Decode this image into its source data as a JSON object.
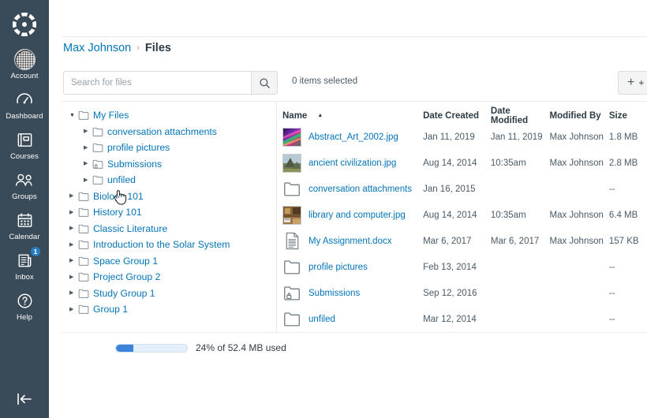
{
  "globalnav": {
    "logo_icon": "canvas-logo-icon",
    "collapse_icon": "collapse-nav-icon",
    "items": [
      {
        "label": "Account",
        "icon": "account-avatar-icon",
        "badge": null
      },
      {
        "label": "Dashboard",
        "icon": "dashboard-icon",
        "badge": null
      },
      {
        "label": "Courses",
        "icon": "courses-icon",
        "badge": null
      },
      {
        "label": "Groups",
        "icon": "groups-icon",
        "badge": null
      },
      {
        "label": "Calendar",
        "icon": "calendar-icon",
        "badge": null
      },
      {
        "label": "Inbox",
        "icon": "inbox-icon",
        "badge": "1"
      },
      {
        "label": "Help",
        "icon": "help-icon",
        "badge": null
      }
    ]
  },
  "breadcrumb": {
    "root": "Max Johnson",
    "separator": "›",
    "current": "Files"
  },
  "toolbar": {
    "search_placeholder": "Search for files",
    "search_value": "",
    "search_icon": "search-icon",
    "selected_text": "0 items selected",
    "folder_button_label": "+ Fol",
    "folder_button_plus": "+"
  },
  "tree": {
    "items": [
      {
        "label": "My Files",
        "level": 0,
        "expanded": true,
        "icon": "folder-icon"
      },
      {
        "label": "conversation attachments",
        "level": 1,
        "expanded": false,
        "icon": "folder-icon"
      },
      {
        "label": "profile pictures",
        "level": 1,
        "expanded": false,
        "icon": "folder-icon"
      },
      {
        "label": "Submissions",
        "level": 1,
        "expanded": false,
        "icon": "folder-locked-icon"
      },
      {
        "label": "unfiled",
        "level": 1,
        "expanded": false,
        "icon": "folder-icon"
      },
      {
        "label": "Biology 101",
        "level": 0,
        "expanded": false,
        "icon": "folder-icon"
      },
      {
        "label": "History 101",
        "level": 0,
        "expanded": false,
        "icon": "folder-icon"
      },
      {
        "label": "Classic Literature",
        "level": 0,
        "expanded": false,
        "icon": "folder-icon"
      },
      {
        "label": "Introduction to the Solar System",
        "level": 0,
        "expanded": false,
        "icon": "folder-icon"
      },
      {
        "label": "Space Group 1",
        "level": 0,
        "expanded": false,
        "icon": "folder-icon"
      },
      {
        "label": "Project Group 2",
        "level": 0,
        "expanded": false,
        "icon": "folder-icon"
      },
      {
        "label": "Study Group 1",
        "level": 0,
        "expanded": false,
        "icon": "folder-icon"
      },
      {
        "label": "Group 1",
        "level": 0,
        "expanded": false,
        "icon": "folder-icon"
      }
    ]
  },
  "table": {
    "columns": [
      "Name",
      "Date Created",
      "Date Modified",
      "Modified By",
      "Size"
    ],
    "sort_column": "Name",
    "sort_direction": "asc",
    "sort_arrow": "▲",
    "rows": [
      {
        "name": "Abstract_Art_2002.jpg",
        "thumb": "image-thumb-abstract-art",
        "date_created": "Jan 11, 2019",
        "date_modified": "Jan 11, 2019",
        "modified_by": "Max Johnson",
        "size": "1.8 MB"
      },
      {
        "name": "ancient civilization.jpg",
        "thumb": "image-thumb-mountain",
        "date_created": "Aug 14, 2014",
        "date_modified": "10:35am",
        "modified_by": "Max Johnson",
        "size": "2.8 MB"
      },
      {
        "name": "conversation attachments",
        "thumb": "folder-icon",
        "date_created": "Jan 16, 2015",
        "date_modified": "",
        "modified_by": "",
        "size": "--"
      },
      {
        "name": "library and computer.jpg",
        "thumb": "image-thumb-library",
        "date_created": "Aug 14, 2014",
        "date_modified": "10:35am",
        "modified_by": "Max Johnson",
        "size": "6.4 MB"
      },
      {
        "name": "My Assignment.docx",
        "thumb": "document-icon",
        "date_created": "Mar 6, 2017",
        "date_modified": "Mar 6, 2017",
        "modified_by": "Max Johnson",
        "size": "157 KB"
      },
      {
        "name": "profile pictures",
        "thumb": "folder-icon",
        "date_created": "Feb 13, 2014",
        "date_modified": "",
        "modified_by": "",
        "size": "--"
      },
      {
        "name": "Submissions",
        "thumb": "folder-locked-icon",
        "date_created": "Sep 12, 2016",
        "date_modified": "",
        "modified_by": "",
        "size": "--"
      },
      {
        "name": "unfiled",
        "thumb": "folder-icon",
        "date_created": "Mar 12, 2014",
        "date_modified": "",
        "modified_by": "",
        "size": "--"
      }
    ]
  },
  "storage": {
    "percent": 24,
    "text": "24% of 52.4 MB used",
    "fill_color": "#3B82D9",
    "track_color": "#E5EFF9"
  },
  "colors": {
    "nav_background": "#394B58",
    "link": "#0374B5",
    "text": "#2D3B45",
    "border": "#e8eaec",
    "badge": "#287CC0"
  },
  "cursor": {
    "icon": "hand-pointer-cursor"
  }
}
